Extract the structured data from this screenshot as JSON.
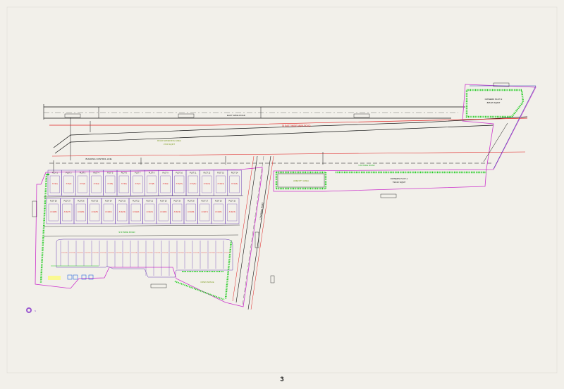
{
  "drawing": {
    "road_main_label": "75 EAST WIDE MAIN ROAD",
    "road_upper_label": "EAST WIDE ROAD",
    "road_setback_label": "ROAD WIDENING AREA",
    "road_setback_area": "3729 SQMT",
    "building_line_label": "BUILDING CONTROL LINE",
    "internal_road_top": "9 M WIDE ROAD",
    "internal_road_mid": "9 M WIDE ROAD",
    "side_road_label": "9 M WIDE ROAD",
    "vertical_road_label": "12 M WIDE ROAD",
    "owners_plot_label": "OWNERS PLOT-1",
    "owners_plot_area": "799.62 SQMT",
    "owners_plot2_label": "OWNERS PLOT-2",
    "owners_plot2_area": "895.35 SQMT",
    "amenity_label": "AMENITY AREA",
    "open_space_label": "OPEN SPACE",
    "row1_plot_nos": [
      "PLOT 1",
      "PLOT 2",
      "PLOT 3",
      "PLOT 4",
      "PLOT 5",
      "PLOT 6",
      "PLOT 7",
      "PLOT 8",
      "PLOT 9",
      "PLOT 10",
      "PLOT 11",
      "PLOT 12",
      "PLOT 13",
      "PLOT 14"
    ],
    "row1_sizes": [
      "A=4(1)",
      "A=4(2)",
      "A=4(3)",
      "A=4(4)",
      "A=4(5)",
      "A=4(6)",
      "A=4(7)",
      "A=4(8)",
      "A=4(9)",
      "A=4(10)",
      "A=4(11)",
      "A=4(12)",
      "A=4(13)",
      "A=4(14)"
    ],
    "row2_plot_nos": [
      "PLOT 28",
      "PLOT 27",
      "PLOT 26",
      "PLOT 25",
      "PLOT 24",
      "PLOT 23",
      "PLOT 22",
      "PLOT 21",
      "PLOT 20",
      "PLOT 19",
      "PLOT 18",
      "PLOT 17",
      "PLOT 16",
      "PLOT 15"
    ],
    "row2_sizes": [
      "A=4(28)",
      "A=4(27)",
      "A=4(26)",
      "A=4(25)",
      "A=4(24)",
      "A=4(23)",
      "A=4(22)",
      "A=4(21)",
      "A=4(20)",
      "A=4(19)",
      "A=4(18)",
      "A=4(17)",
      "A=4(16)",
      "A=4(15)"
    ],
    "row3_sizes": [
      "PLOT 29",
      "PLOT 30",
      "PLOT 31",
      "PLOT 32",
      "PLOT 33",
      "PLOT 34",
      "PLOT 35",
      "PLOT 36",
      "PLOT 37",
      "PLOT 38",
      "PLOT 39",
      "PLOT 40",
      "PLOT 41",
      "PLOT 42",
      "PLOT 43",
      "PLOT 44",
      "PLOT 45",
      "PLOT 46",
      "PLOT 47",
      "PLOT 48",
      "PLOT 49",
      "PLOT 50"
    ],
    "north_label": "N",
    "dim_labels": [
      "EXISTING",
      "EXISTING",
      "EXISTING",
      "EXISTING",
      "EXISTING",
      "EXISTING",
      "EXISTING",
      "EXISTING"
    ]
  },
  "page_number": "3",
  "colors": {
    "background": "#f2f0ea",
    "boundary": "#cc33cc",
    "road_line": "#111111",
    "red_line": "#e02020",
    "green_hatch": "#22cc22",
    "plot_line": "#6a3fb5",
    "plot_label": "#e02020",
    "road_text": "#7a9a1a"
  }
}
